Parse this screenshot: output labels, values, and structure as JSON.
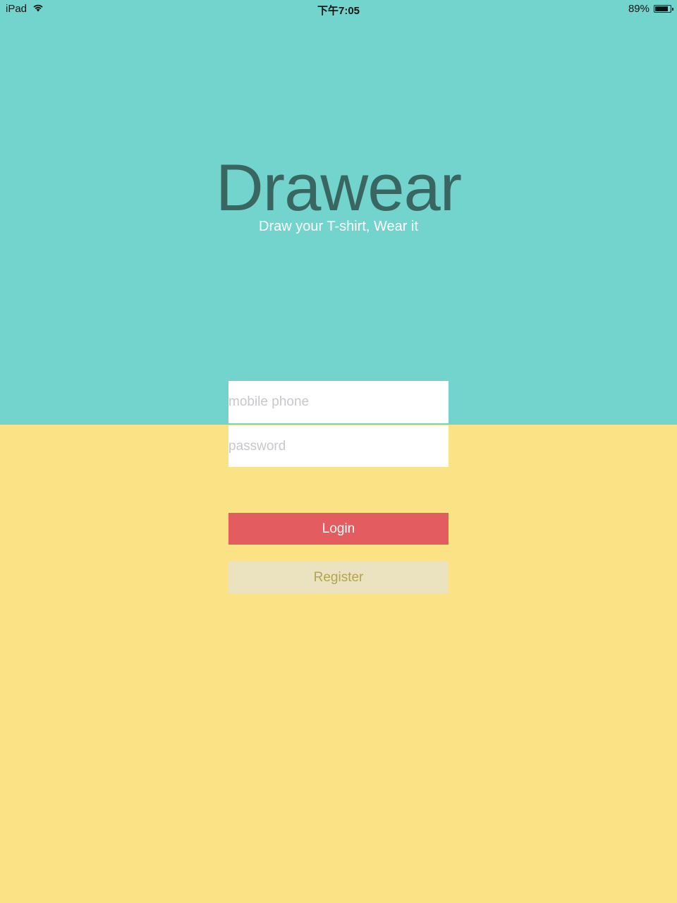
{
  "status_bar": {
    "device": "iPad",
    "time": "下午7:05",
    "battery_percent": "89%",
    "battery_level": 0.89,
    "wifi_icon": "wifi-icon",
    "battery_icon": "battery-icon"
  },
  "brand": {
    "title": "Drawear",
    "tagline": "Draw your T-shirt, Wear it"
  },
  "form": {
    "phone_placeholder": "mobile phone",
    "phone_value": "",
    "password_placeholder": "password",
    "password_value": ""
  },
  "buttons": {
    "login_label": "Login",
    "register_label": "Register"
  },
  "colors": {
    "top_background": "#73d3cd",
    "bottom_background": "#fbe284",
    "title": "#3a6662",
    "login": "#e25c60",
    "register": "#ebe2bf",
    "register_text": "#b3a44f"
  }
}
